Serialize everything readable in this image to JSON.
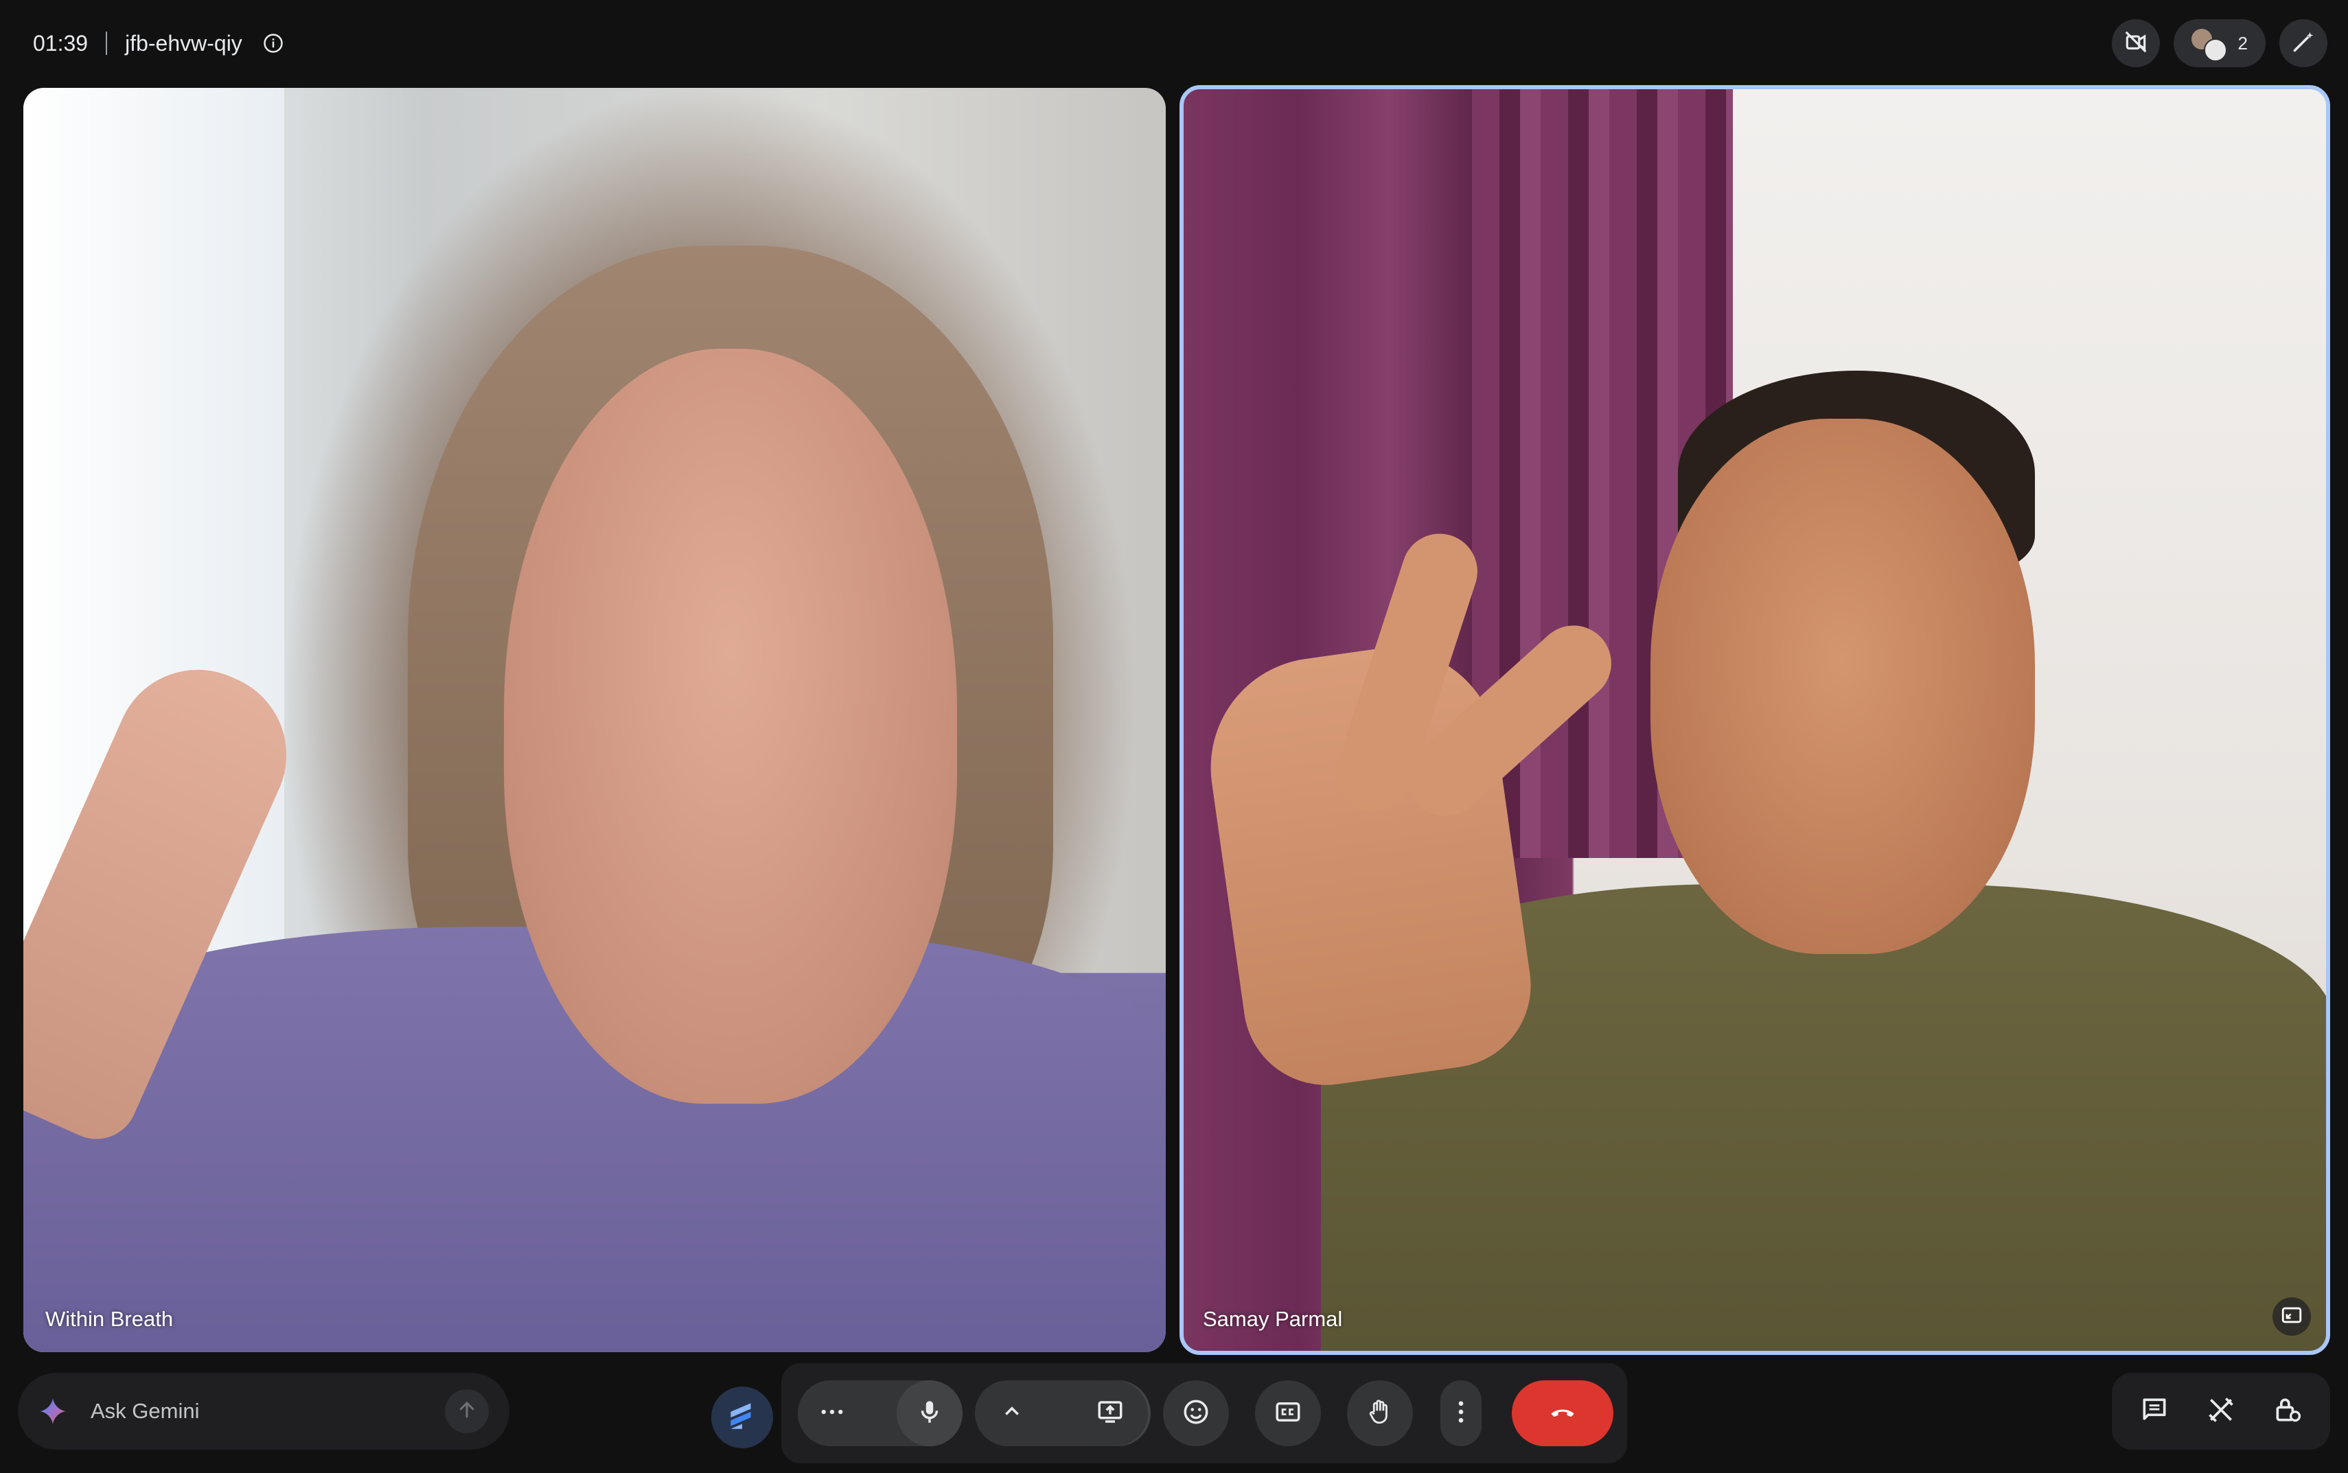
{
  "meeting": {
    "time": "01:39",
    "code": "jfb-ehvw-qiy"
  },
  "top_actions": {
    "people_count": "2"
  },
  "tiles": [
    {
      "name": "Within Breath",
      "highlighted": false
    },
    {
      "name": "Samay Parmal",
      "highlighted": true
    }
  ],
  "gemini": {
    "placeholder": "Ask Gemini"
  },
  "controls": {
    "more_label": "···",
    "end_call_color": "#dc362e"
  },
  "colors": {
    "background": "#111111",
    "accent_border": "#a8c7fa",
    "end_call": "#dc362e",
    "control_bg": "#333537"
  },
  "icons": [
    "info-icon",
    "no-recording-icon",
    "people-icon",
    "edit-wand-icon",
    "pip-icon",
    "gemini-sparkle-icon",
    "send-arrow-icon",
    "companion-icon",
    "more-horiz-icon",
    "mic-icon",
    "chevron-up-icon",
    "camera-icon",
    "present-icon",
    "emoji-icon",
    "captions-icon",
    "raise-hand-icon",
    "more-vert-icon",
    "end-call-icon",
    "chat-icon",
    "activities-icon",
    "host-controls-icon"
  ]
}
